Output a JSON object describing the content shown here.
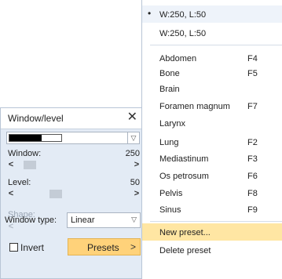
{
  "panel": {
    "title": "Window/level",
    "close_glyph": "✕",
    "window_label": "Window:",
    "window_value": "250",
    "level_label": "Level:",
    "level_value": "50",
    "shape_label": "Shape:",
    "window_type_label": "Window type:",
    "window_type_value": "Linear",
    "invert_label": "Invert",
    "invert_checked": false,
    "presets_label": "Presets",
    "arrow_left": "<",
    "arrow_right": ">",
    "dropdown_arrow": "▽",
    "submenu_arrow": ">"
  },
  "menu": {
    "bullet_glyph": "•",
    "items": [
      {
        "label": "W:250, L:50",
        "shortcut": "",
        "checked": true
      },
      {
        "label": "W:250, L:50",
        "shortcut": ""
      },
      {
        "label": "Abdomen",
        "shortcut": "F4"
      },
      {
        "label": "Bone",
        "shortcut": "F5"
      },
      {
        "label": "Brain",
        "shortcut": ""
      },
      {
        "label": "Foramen magnum",
        "shortcut": "F7"
      },
      {
        "label": "Larynx",
        "shortcut": ""
      },
      {
        "label": "Lung",
        "shortcut": "F2"
      },
      {
        "label": "Mediastinum",
        "shortcut": "F3"
      },
      {
        "label": "Os petrosum",
        "shortcut": "F6"
      },
      {
        "label": "Pelvis",
        "shortcut": "F8"
      },
      {
        "label": "Sinus",
        "shortcut": "F9"
      },
      {
        "label": "New preset...",
        "shortcut": "",
        "highlighted": true
      },
      {
        "label": "Delete preset",
        "shortcut": ""
      }
    ]
  },
  "colors": {
    "panel_bg": "#e3ebf5",
    "accent": "#ffd27a",
    "menu_highlight": "#ffe6a3"
  }
}
